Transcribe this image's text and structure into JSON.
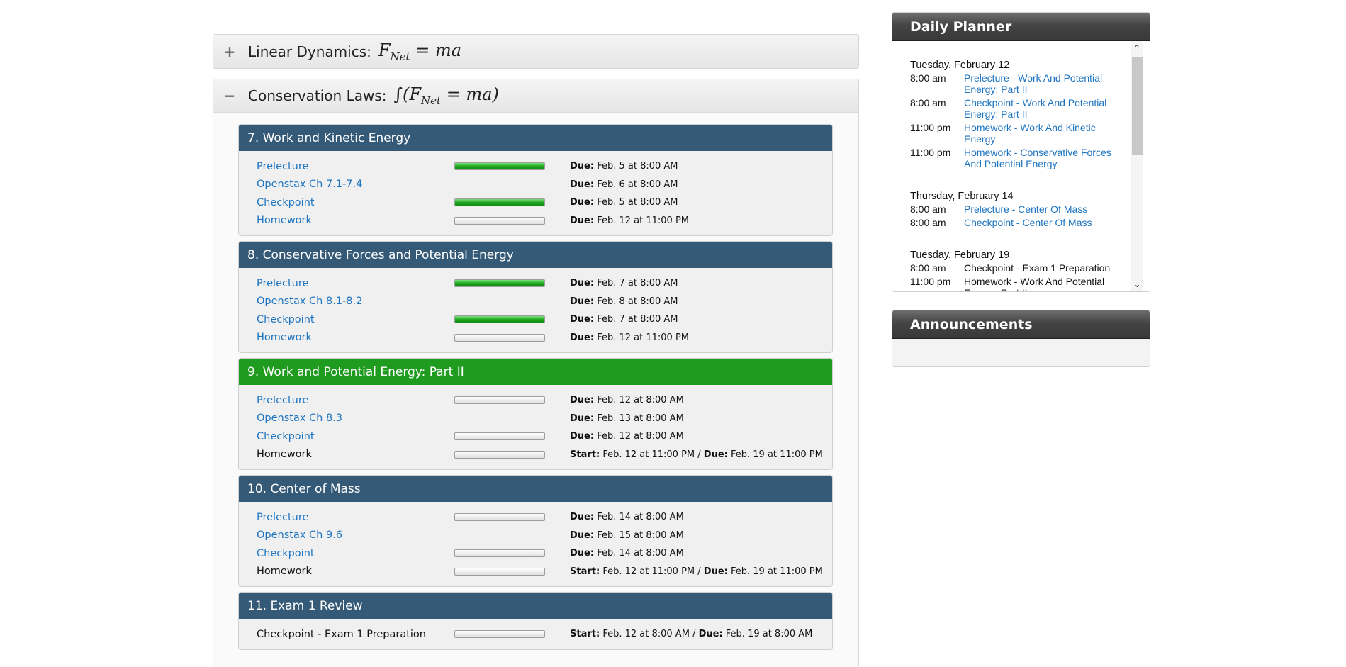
{
  "units": [
    {
      "toggle": "+",
      "title": "Linear Dynamics:",
      "formula": "F",
      "formula_sub": "Net",
      "formula_rest": " = ma",
      "formula_pre": ""
    },
    {
      "toggle": "−",
      "title": "Conservation Laws:",
      "formula_pre": "∫(F",
      "formula_sub": "Net",
      "formula_rest": " = ma)"
    }
  ],
  "lessons": [
    {
      "title": "7. Work and Kinetic Energy",
      "current": false,
      "items": [
        {
          "name": "Prelecture",
          "link": true,
          "progress": 1.0,
          "due": "Feb. 5 at 8:00 AM"
        },
        {
          "name": "Openstax Ch 7.1-7.4",
          "link": true,
          "progress": null,
          "due": "Feb. 6 at 8:00 AM"
        },
        {
          "name": "Checkpoint",
          "link": true,
          "progress": 1.0,
          "due": "Feb. 5 at 8:00 AM"
        },
        {
          "name": "Homework",
          "link": true,
          "progress": 0.0,
          "due": "Feb. 12 at 11:00 PM"
        }
      ]
    },
    {
      "title": "8. Conservative Forces and Potential Energy",
      "current": false,
      "items": [
        {
          "name": "Prelecture",
          "link": true,
          "progress": 1.0,
          "due": "Feb. 7 at 8:00 AM"
        },
        {
          "name": "Openstax Ch 8.1-8.2",
          "link": true,
          "progress": null,
          "due": "Feb. 8 at 8:00 AM"
        },
        {
          "name": "Checkpoint",
          "link": true,
          "progress": 1.0,
          "due": "Feb. 7 at 8:00 AM"
        },
        {
          "name": "Homework",
          "link": true,
          "progress": 0.0,
          "due": "Feb. 12 at 11:00 PM"
        }
      ]
    },
    {
      "title": "9. Work and Potential Energy: Part II",
      "current": true,
      "items": [
        {
          "name": "Prelecture",
          "link": true,
          "progress": 0.0,
          "due": "Feb. 12 at 8:00 AM"
        },
        {
          "name": "Openstax Ch 8.3",
          "link": true,
          "progress": null,
          "due": "Feb. 13 at 8:00 AM"
        },
        {
          "name": "Checkpoint",
          "link": true,
          "progress": 0.0,
          "due": "Feb. 12 at 8:00 AM"
        },
        {
          "name": "Homework",
          "link": false,
          "progress": 0.0,
          "start": "Feb. 12 at 11:00 PM",
          "due": "Feb. 19 at 11:00 PM"
        }
      ]
    },
    {
      "title": "10. Center of Mass",
      "current": false,
      "items": [
        {
          "name": "Prelecture",
          "link": true,
          "progress": 0.0,
          "due": "Feb. 14 at 8:00 AM"
        },
        {
          "name": "Openstax Ch 9.6",
          "link": true,
          "progress": null,
          "due": "Feb. 15 at 8:00 AM"
        },
        {
          "name": "Checkpoint",
          "link": true,
          "progress": 0.0,
          "due": "Feb. 14 at 8:00 AM"
        },
        {
          "name": "Homework",
          "link": false,
          "progress": 0.0,
          "start": "Feb. 12 at 11:00 PM",
          "due": "Feb. 19 at 11:00 PM"
        }
      ]
    },
    {
      "title": "11. Exam 1 Review",
      "current": false,
      "items": [
        {
          "name": "Checkpoint - Exam 1 Preparation",
          "link": false,
          "progress": 0.0,
          "start": "Feb. 12 at 8:00 AM",
          "due": "Feb. 19 at 8:00 AM"
        }
      ]
    }
  ],
  "labels": {
    "due": "Due:",
    "start": "Start:"
  },
  "planner": {
    "title": "Daily Planner",
    "days": [
      {
        "date": "Tuesday, February 12",
        "events": [
          {
            "time": "8:00 am",
            "text": "Prelecture - Work And Potential Energy: Part II",
            "link": true
          },
          {
            "time": "8:00 am",
            "text": "Checkpoint - Work And Potential Energy: Part II",
            "link": true
          },
          {
            "time": "11:00 pm",
            "text": "Homework - Work And Kinetic Energy",
            "link": true
          },
          {
            "time": "11:00 pm",
            "text": "Homework - Conservative Forces And Potential Energy",
            "link": true
          }
        ]
      },
      {
        "date": "Thursday, February 14",
        "events": [
          {
            "time": "8:00 am",
            "text": "Prelecture - Center Of Mass",
            "link": true
          },
          {
            "time": "8:00 am",
            "text": "Checkpoint - Center Of Mass",
            "link": true
          }
        ]
      },
      {
        "date": "Tuesday, February 19",
        "events": [
          {
            "time": "8:00 am",
            "text": "Checkpoint - Exam 1 Preparation",
            "link": false
          },
          {
            "time": "11:00 pm",
            "text": "Homework - Work And Potential Energy: Part II",
            "link": false
          }
        ]
      }
    ],
    "scroll_up": "⌃",
    "scroll_down": "⌄"
  },
  "announcements": {
    "title": "Announcements"
  },
  "colors": {
    "lesson_header": "#355a78",
    "lesson_current": "#1f9b1f",
    "link": "#1d74c0",
    "progress_fill": "#1aa21a"
  }
}
